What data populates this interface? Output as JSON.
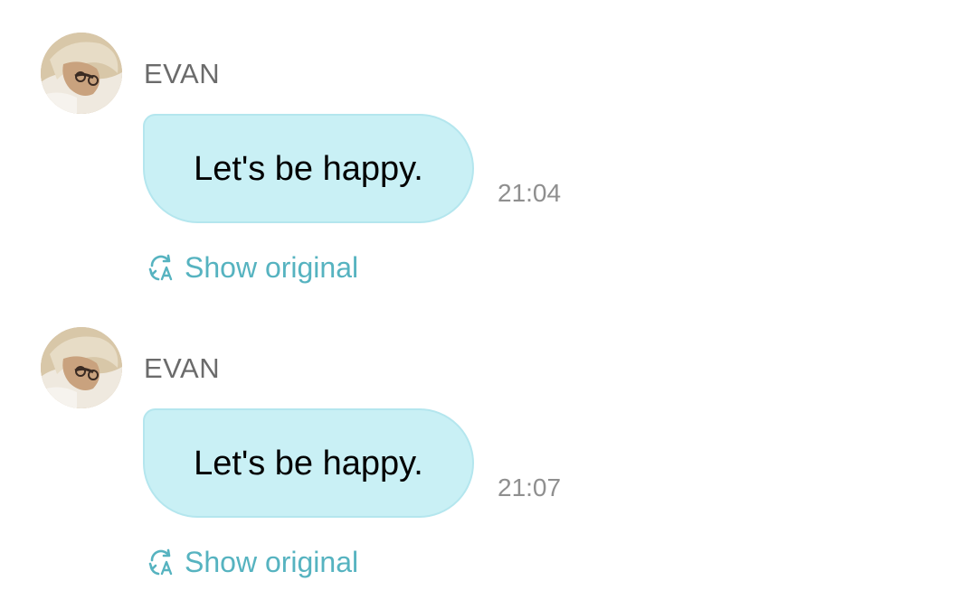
{
  "messages": [
    {
      "sender": "EVAN",
      "text": "Let's be happy.",
      "time": "21:04",
      "action_label": "Show original"
    },
    {
      "sender": "EVAN",
      "text": "Let's be happy.",
      "time": "21:07",
      "action_label": "Show original"
    }
  ],
  "icons": {
    "translate": "translate-icon",
    "avatar": "avatar"
  },
  "colors": {
    "bubble_background": "#c9f0f5",
    "bubble_border": "#b4e6ee",
    "link_accent": "#56b3c0",
    "sender_text": "#6b6b6b",
    "timestamp_text": "#8f8f8f"
  }
}
